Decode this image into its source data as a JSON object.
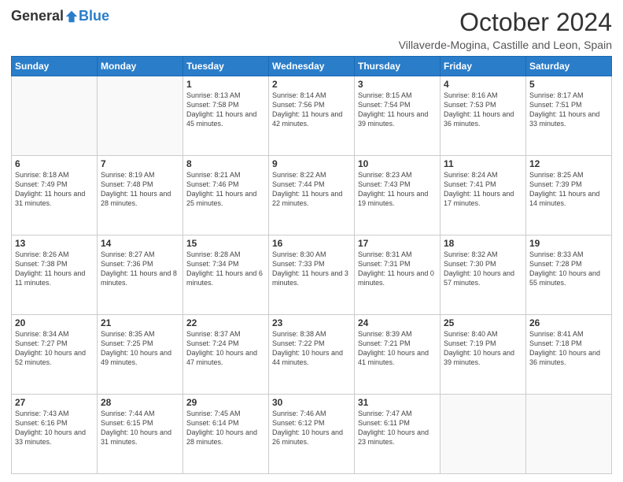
{
  "logo": {
    "general": "General",
    "blue": "Blue"
  },
  "header": {
    "month": "October 2024",
    "location": "Villaverde-Mogina, Castille and Leon, Spain"
  },
  "weekdays": [
    "Sunday",
    "Monday",
    "Tuesday",
    "Wednesday",
    "Thursday",
    "Friday",
    "Saturday"
  ],
  "weeks": [
    [
      {
        "day": "",
        "info": ""
      },
      {
        "day": "",
        "info": ""
      },
      {
        "day": "1",
        "info": "Sunrise: 8:13 AM\nSunset: 7:58 PM\nDaylight: 11 hours and 45 minutes."
      },
      {
        "day": "2",
        "info": "Sunrise: 8:14 AM\nSunset: 7:56 PM\nDaylight: 11 hours and 42 minutes."
      },
      {
        "day": "3",
        "info": "Sunrise: 8:15 AM\nSunset: 7:54 PM\nDaylight: 11 hours and 39 minutes."
      },
      {
        "day": "4",
        "info": "Sunrise: 8:16 AM\nSunset: 7:53 PM\nDaylight: 11 hours and 36 minutes."
      },
      {
        "day": "5",
        "info": "Sunrise: 8:17 AM\nSunset: 7:51 PM\nDaylight: 11 hours and 33 minutes."
      }
    ],
    [
      {
        "day": "6",
        "info": "Sunrise: 8:18 AM\nSunset: 7:49 PM\nDaylight: 11 hours and 31 minutes."
      },
      {
        "day": "7",
        "info": "Sunrise: 8:19 AM\nSunset: 7:48 PM\nDaylight: 11 hours and 28 minutes."
      },
      {
        "day": "8",
        "info": "Sunrise: 8:21 AM\nSunset: 7:46 PM\nDaylight: 11 hours and 25 minutes."
      },
      {
        "day": "9",
        "info": "Sunrise: 8:22 AM\nSunset: 7:44 PM\nDaylight: 11 hours and 22 minutes."
      },
      {
        "day": "10",
        "info": "Sunrise: 8:23 AM\nSunset: 7:43 PM\nDaylight: 11 hours and 19 minutes."
      },
      {
        "day": "11",
        "info": "Sunrise: 8:24 AM\nSunset: 7:41 PM\nDaylight: 11 hours and 17 minutes."
      },
      {
        "day": "12",
        "info": "Sunrise: 8:25 AM\nSunset: 7:39 PM\nDaylight: 11 hours and 14 minutes."
      }
    ],
    [
      {
        "day": "13",
        "info": "Sunrise: 8:26 AM\nSunset: 7:38 PM\nDaylight: 11 hours and 11 minutes."
      },
      {
        "day": "14",
        "info": "Sunrise: 8:27 AM\nSunset: 7:36 PM\nDaylight: 11 hours and 8 minutes."
      },
      {
        "day": "15",
        "info": "Sunrise: 8:28 AM\nSunset: 7:34 PM\nDaylight: 11 hours and 6 minutes."
      },
      {
        "day": "16",
        "info": "Sunrise: 8:30 AM\nSunset: 7:33 PM\nDaylight: 11 hours and 3 minutes."
      },
      {
        "day": "17",
        "info": "Sunrise: 8:31 AM\nSunset: 7:31 PM\nDaylight: 11 hours and 0 minutes."
      },
      {
        "day": "18",
        "info": "Sunrise: 8:32 AM\nSunset: 7:30 PM\nDaylight: 10 hours and 57 minutes."
      },
      {
        "day": "19",
        "info": "Sunrise: 8:33 AM\nSunset: 7:28 PM\nDaylight: 10 hours and 55 minutes."
      }
    ],
    [
      {
        "day": "20",
        "info": "Sunrise: 8:34 AM\nSunset: 7:27 PM\nDaylight: 10 hours and 52 minutes."
      },
      {
        "day": "21",
        "info": "Sunrise: 8:35 AM\nSunset: 7:25 PM\nDaylight: 10 hours and 49 minutes."
      },
      {
        "day": "22",
        "info": "Sunrise: 8:37 AM\nSunset: 7:24 PM\nDaylight: 10 hours and 47 minutes."
      },
      {
        "day": "23",
        "info": "Sunrise: 8:38 AM\nSunset: 7:22 PM\nDaylight: 10 hours and 44 minutes."
      },
      {
        "day": "24",
        "info": "Sunrise: 8:39 AM\nSunset: 7:21 PM\nDaylight: 10 hours and 41 minutes."
      },
      {
        "day": "25",
        "info": "Sunrise: 8:40 AM\nSunset: 7:19 PM\nDaylight: 10 hours and 39 minutes."
      },
      {
        "day": "26",
        "info": "Sunrise: 8:41 AM\nSunset: 7:18 PM\nDaylight: 10 hours and 36 minutes."
      }
    ],
    [
      {
        "day": "27",
        "info": "Sunrise: 7:43 AM\nSunset: 6:16 PM\nDaylight: 10 hours and 33 minutes."
      },
      {
        "day": "28",
        "info": "Sunrise: 7:44 AM\nSunset: 6:15 PM\nDaylight: 10 hours and 31 minutes."
      },
      {
        "day": "29",
        "info": "Sunrise: 7:45 AM\nSunset: 6:14 PM\nDaylight: 10 hours and 28 minutes."
      },
      {
        "day": "30",
        "info": "Sunrise: 7:46 AM\nSunset: 6:12 PM\nDaylight: 10 hours and 26 minutes."
      },
      {
        "day": "31",
        "info": "Sunrise: 7:47 AM\nSunset: 6:11 PM\nDaylight: 10 hours and 23 minutes."
      },
      {
        "day": "",
        "info": ""
      },
      {
        "day": "",
        "info": ""
      }
    ]
  ]
}
